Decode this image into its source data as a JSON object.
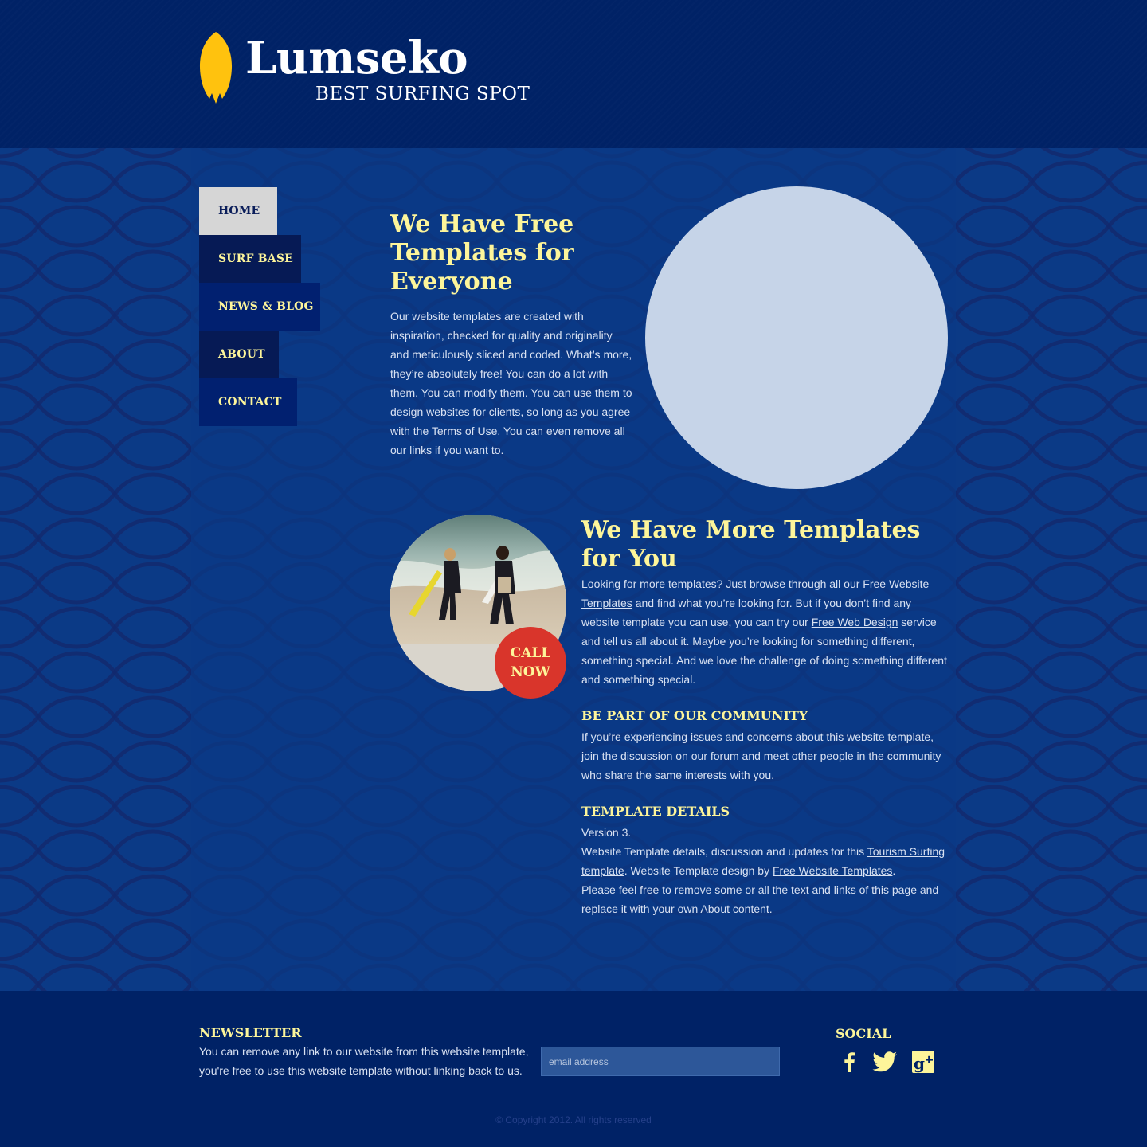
{
  "colors": {
    "header_bg": "#002266",
    "content_bg": "#0b3a86",
    "accent_yellow": "#fdf59a",
    "nav_active_bg": "#d6d6d6",
    "badge_red": "#d9352b",
    "placeholder_circle": "#c6d4e8",
    "logo_board": "#ffc20e"
  },
  "header": {
    "logo_icon": "surfboard-icon",
    "title": "Lumseko",
    "tagline": "BEST SURFING SPOT"
  },
  "nav": {
    "home": "HOME",
    "surf_base": "SURF BASE",
    "news_blog": "NEWS & BLOG",
    "about": "ABOUT",
    "contact": "CONTACT",
    "active": "HOME"
  },
  "intro": {
    "heading": "We Have Free Templates for Everyone",
    "text_before_link": "Our website templates are created with inspiration, checked for quality and originality and meticulously sliced and coded. What’s more, they’re absolutely free! You can do a lot with them. You can modify them. You can use them to design websites for clients, so long as you agree with the ",
    "link": "Terms of Use",
    "text_after_link": ". You can even remove all our links if you want to."
  },
  "feature": {
    "call_line1": "CALL",
    "call_line2": "NOW"
  },
  "more": {
    "heading": "We Have More Templates for You",
    "t1": "Looking for more templates? Just browse through all our ",
    "link1": "Free Website Templates",
    "t2": " and find what you’re looking for. But if you don’t find any website template you can use, you can try our ",
    "link2": "Free Web Design",
    "t3": " service and tell us all about it. Maybe you’re looking for something different, something special. And we love the challenge of doing something different and something special."
  },
  "community": {
    "heading": "BE PART OF OUR COMMUNITY",
    "t1": "If you’re experiencing issues and concerns about this website template, join the discussion ",
    "link": "on our forum",
    "t2": " and meet other people in the community who share the same interests with you."
  },
  "details": {
    "heading": "TEMPLATE DETAILS",
    "version": "Version 3.",
    "t1": "Website Template details, discussion and updates for this ",
    "link1": "Tourism Surfing template",
    "t2": ". Website Template design by ",
    "link2": "Free Website Templates",
    "t3": ".",
    "t4": "Please feel free to remove some or all the text and links of this page and replace it with your own About content."
  },
  "footer": {
    "newsletter_heading": "NEWSLETTER",
    "newsletter_text": "You can remove any link to our website from this website template, you're free to use this website template without linking back to us.",
    "email_placeholder": "email address",
    "email_value": "",
    "social_heading": "SOCIAL",
    "social_icons": [
      "facebook-icon",
      "twitter-icon",
      "google-plus-icon"
    ],
    "copyright": "© Copyright 2012. All rights reserved"
  }
}
